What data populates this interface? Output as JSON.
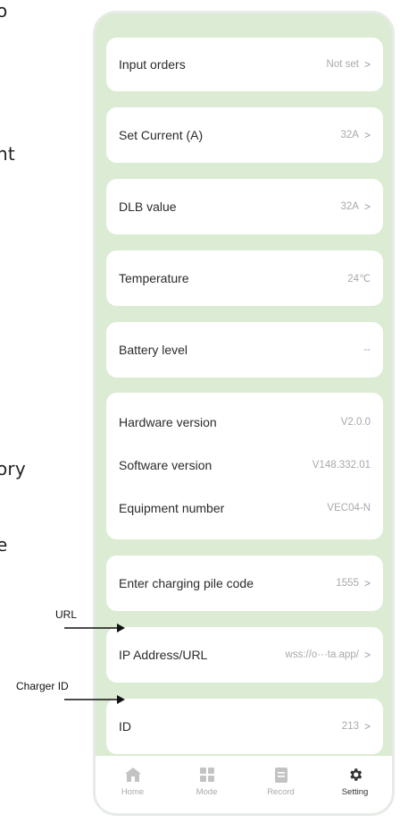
{
  "background_text": [
    "o",
    "nt",
    "ory",
    "e"
  ],
  "settings": [
    {
      "label": "Input orders",
      "value": "Not set",
      "chevron": true
    },
    {
      "label": "Set Current (A)",
      "value": "32A",
      "chevron": true
    },
    {
      "label": "DLB value",
      "value": "32A",
      "chevron": true
    },
    {
      "label": "Temperature",
      "value": "24℃",
      "chevron": false
    },
    {
      "label": "Battery level",
      "value": "--",
      "chevron": false
    },
    {
      "label": "Hardware version",
      "value": "V2.0.0",
      "chevron": false
    },
    {
      "label": "Software version",
      "value": "V148.332.01",
      "chevron": false
    },
    {
      "label": "Equipment number",
      "value": "VEC04-N",
      "chevron": false
    },
    {
      "label": "Enter charging pile code",
      "value": "1555",
      "chevron": true
    },
    {
      "label": "IP Address/URL",
      "value": "wss://o···ta.app/",
      "chevron": true
    },
    {
      "label": "ID",
      "value": "213",
      "chevron": true
    }
  ],
  "chevron_glyph": ">",
  "tabs": [
    {
      "label": "Home",
      "icon": "home-icon",
      "active": false
    },
    {
      "label": "Mode",
      "icon": "grid-icon",
      "active": false
    },
    {
      "label": "Record",
      "icon": "record-icon",
      "active": false
    },
    {
      "label": "Setting",
      "icon": "gear-icon",
      "active": true
    }
  ],
  "annotations": {
    "url": "URL",
    "charger_id": "Charger ID"
  },
  "colors": {
    "screen_bg": "#dcebd3",
    "card_bg": "#ffffff",
    "value_text": "#a9a9a9",
    "active_icon": "#333333",
    "inactive_icon": "#c3c3c3"
  }
}
